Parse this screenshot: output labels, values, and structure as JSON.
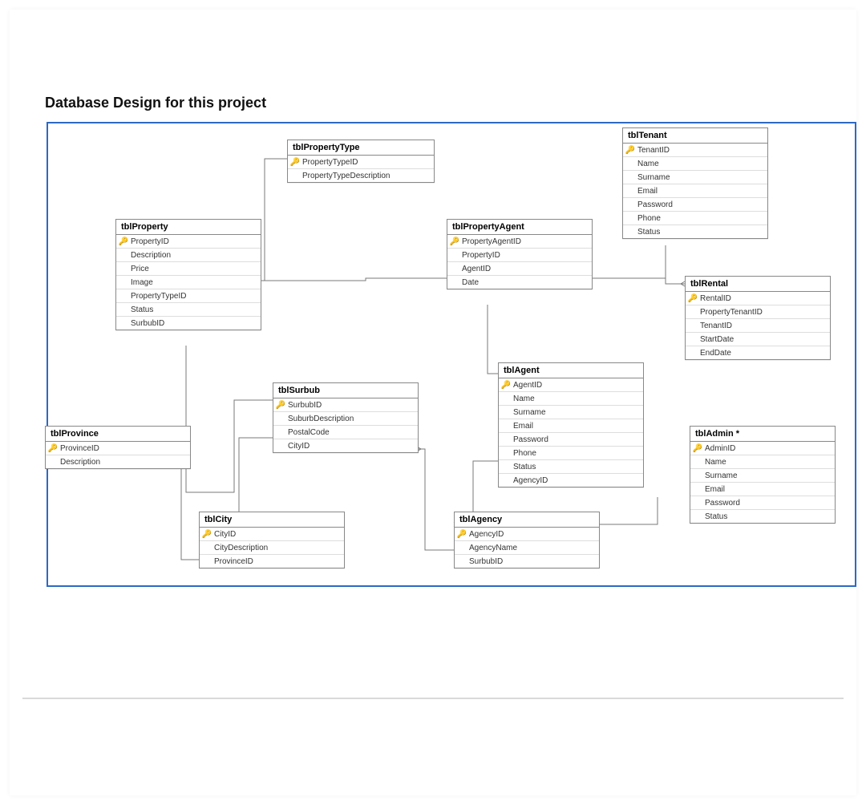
{
  "page_title": "Database Design for this project",
  "tables": {
    "property_type": {
      "name": "tblPropertyType",
      "cols": [
        {
          "k": true,
          "n": "PropertyTypeID"
        },
        {
          "k": false,
          "n": "PropertyTypeDescription"
        }
      ]
    },
    "property": {
      "name": "tblProperty",
      "cols": [
        {
          "k": true,
          "n": "PropertyID"
        },
        {
          "k": false,
          "n": "Description"
        },
        {
          "k": false,
          "n": "Price"
        },
        {
          "k": false,
          "n": "Image"
        },
        {
          "k": false,
          "n": "PropertyTypeID"
        },
        {
          "k": false,
          "n": "Status"
        },
        {
          "k": false,
          "n": "SurbubID"
        }
      ]
    },
    "property_agent": {
      "name": "tblPropertyAgent",
      "cols": [
        {
          "k": true,
          "n": "PropertyAgentID"
        },
        {
          "k": false,
          "n": "PropertyID"
        },
        {
          "k": false,
          "n": "AgentID"
        },
        {
          "k": false,
          "n": "Date"
        }
      ]
    },
    "tenant": {
      "name": "tblTenant",
      "cols": [
        {
          "k": true,
          "n": "TenantID"
        },
        {
          "k": false,
          "n": "Name"
        },
        {
          "k": false,
          "n": "Surname"
        },
        {
          "k": false,
          "n": "Email"
        },
        {
          "k": false,
          "n": "Password"
        },
        {
          "k": false,
          "n": "Phone"
        },
        {
          "k": false,
          "n": "Status"
        }
      ]
    },
    "rental": {
      "name": "tblRental",
      "cols": [
        {
          "k": true,
          "n": "RentalID"
        },
        {
          "k": false,
          "n": "PropertyTenantID"
        },
        {
          "k": false,
          "n": "TenantID"
        },
        {
          "k": false,
          "n": "StartDate"
        },
        {
          "k": false,
          "n": "EndDate"
        }
      ]
    },
    "province": {
      "name": "tblProvince",
      "cols": [
        {
          "k": true,
          "n": "ProvinceID"
        },
        {
          "k": false,
          "n": "Description"
        }
      ]
    },
    "surbub": {
      "name": "tblSurbub",
      "cols": [
        {
          "k": true,
          "n": "SurbubID"
        },
        {
          "k": false,
          "n": "SuburbDescription"
        },
        {
          "k": false,
          "n": "PostalCode"
        },
        {
          "k": false,
          "n": "CityID"
        }
      ]
    },
    "agent": {
      "name": "tblAgent",
      "cols": [
        {
          "k": true,
          "n": "AgentID"
        },
        {
          "k": false,
          "n": "Name"
        },
        {
          "k": false,
          "n": "Surname"
        },
        {
          "k": false,
          "n": "Email"
        },
        {
          "k": false,
          "n": "Password"
        },
        {
          "k": false,
          "n": "Phone"
        },
        {
          "k": false,
          "n": "Status"
        },
        {
          "k": false,
          "n": "AgencyID"
        }
      ]
    },
    "admin": {
      "name": "tblAdmin *",
      "cols": [
        {
          "k": true,
          "n": "AdminID"
        },
        {
          "k": false,
          "n": "Name"
        },
        {
          "k": false,
          "n": "Surname"
        },
        {
          "k": false,
          "n": "Email"
        },
        {
          "k": false,
          "n": "Password"
        },
        {
          "k": false,
          "n": "Status"
        }
      ]
    },
    "city": {
      "name": "tblCity",
      "cols": [
        {
          "k": true,
          "n": "CityID"
        },
        {
          "k": false,
          "n": "CityDescription"
        },
        {
          "k": false,
          "n": "ProvinceID"
        }
      ]
    },
    "agency": {
      "name": "tblAgency",
      "cols": [
        {
          "k": true,
          "n": "AgencyID"
        },
        {
          "k": false,
          "n": "AgencyName"
        },
        {
          "k": false,
          "n": "SurbubID"
        }
      ]
    }
  },
  "key_glyph": "🔑"
}
